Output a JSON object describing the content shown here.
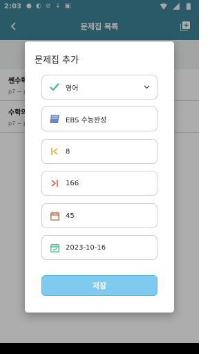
{
  "status": {
    "time": "2:03"
  },
  "appbar": {
    "title": "문제집 목록",
    "back_icon": "arrow-back-icon",
    "add_icon": "add-box-icon"
  },
  "list": {
    "items": [
      {
        "name": "쎈수학",
        "sub": "p7 ~ p"
      },
      {
        "name": "수학의",
        "sub": "p7 ~ p"
      }
    ]
  },
  "dialog": {
    "title": "문제집 추가",
    "subject": "영어",
    "book_name": "EBS 수능완성",
    "start_page": "8",
    "end_page": "166",
    "days": "45",
    "date": "2023-10-16",
    "save_label": "저장"
  },
  "colors": {
    "appbar": "#3f8599",
    "save_button": "#7ecbef",
    "check": "#3cbf8c",
    "start_icon": "#f2a623",
    "end_icon": "#e25541",
    "calendar": "#c76a3c",
    "event_icon": "#3cbf8c"
  }
}
